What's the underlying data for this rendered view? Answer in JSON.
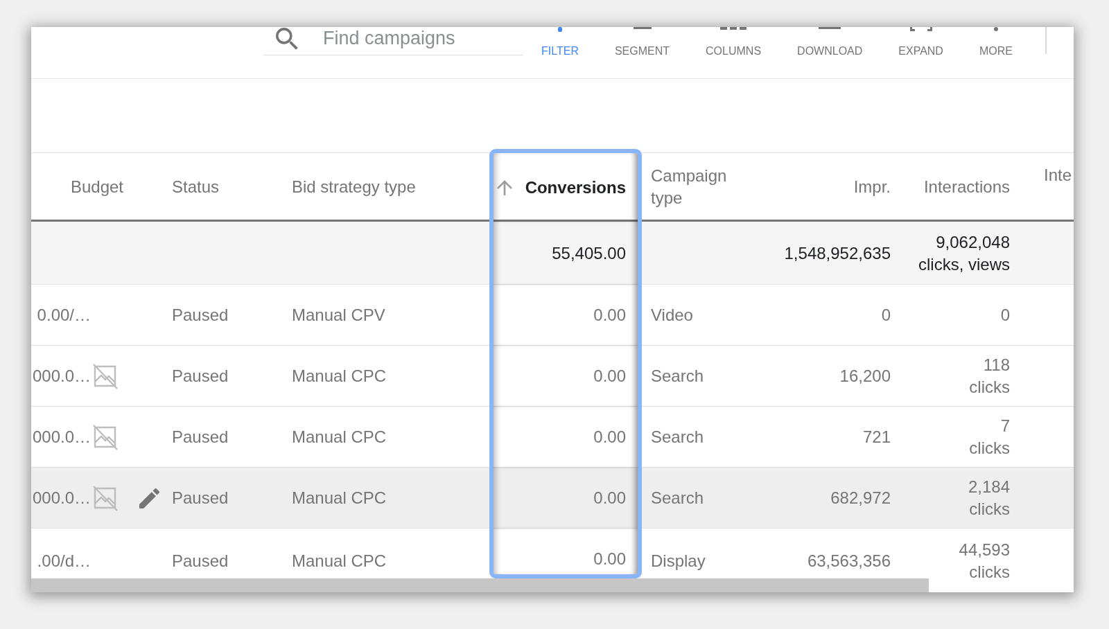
{
  "toolbar": {
    "search": {
      "placeholder": "Find campaigns"
    },
    "buttons": [
      {
        "kind": "filter",
        "label": "FILTER",
        "active": true
      },
      {
        "kind": "segment",
        "label": "SEGMENT",
        "active": false
      },
      {
        "kind": "columns",
        "label": "COLUMNS",
        "active": false
      },
      {
        "kind": "download",
        "label": "DOWNLOAD",
        "active": false
      },
      {
        "kind": "expand",
        "label": "EXPAND",
        "active": false
      },
      {
        "kind": "more",
        "label": "MORE",
        "active": false
      }
    ]
  },
  "table": {
    "columns": [
      {
        "label": "Budget",
        "sorted": false,
        "highlighted": false
      },
      {
        "label": "Status",
        "sorted": false,
        "highlighted": false
      },
      {
        "label": "Bid strategy type",
        "sorted": false,
        "highlighted": false
      },
      {
        "label": "Conversions",
        "sorted": true,
        "highlighted": true
      },
      {
        "label": "Campaign type",
        "sorted": false,
        "highlighted": false
      },
      {
        "label": "Impr.",
        "sorted": false,
        "highlighted": false
      },
      {
        "label": "Interactions",
        "sorted": false,
        "highlighted": false
      },
      {
        "label": "Inte",
        "sorted": false,
        "highlighted": false
      }
    ],
    "totals": {
      "conversions": "55,405.00",
      "impressions": "1,548,952,635",
      "interactions": "9,062,048\nclicks, views"
    },
    "rows": [
      {
        "hovered": false,
        "budget": "0.00/…",
        "budget_icon": false,
        "status": "Paused",
        "bid_strategy_type": "Manual CPV",
        "conversions": "0.00",
        "campaign_type": "Video",
        "impressions": "0",
        "interactions": "0"
      },
      {
        "hovered": false,
        "budget": "000.0…",
        "budget_icon": true,
        "status": "Paused",
        "bid_strategy_type": "Manual CPC",
        "conversions": "0.00",
        "campaign_type": "Search",
        "impressions": "16,200",
        "interactions": "118\nclicks"
      },
      {
        "hovered": false,
        "budget": "000.0…",
        "budget_icon": true,
        "status": "Paused",
        "bid_strategy_type": "Manual CPC",
        "conversions": "0.00",
        "campaign_type": "Search",
        "impressions": "721",
        "interactions": "7\nclicks"
      },
      {
        "hovered": true,
        "budget": "000.0…",
        "budget_icon": true,
        "status": "Paused",
        "bid_strategy_type": "Manual CPC",
        "conversions": "0.00",
        "campaign_type": "Search",
        "impressions": "682,972",
        "interactions": "2,184\nclicks"
      },
      {
        "hovered": false,
        "budget": ".00/d…",
        "budget_icon": false,
        "status": "Paused",
        "bid_strategy_type": "Manual CPC",
        "conversions": "0.00",
        "campaign_type": "Display",
        "impressions": "63,563,356",
        "interactions": "44,593\nclicks"
      }
    ]
  }
}
